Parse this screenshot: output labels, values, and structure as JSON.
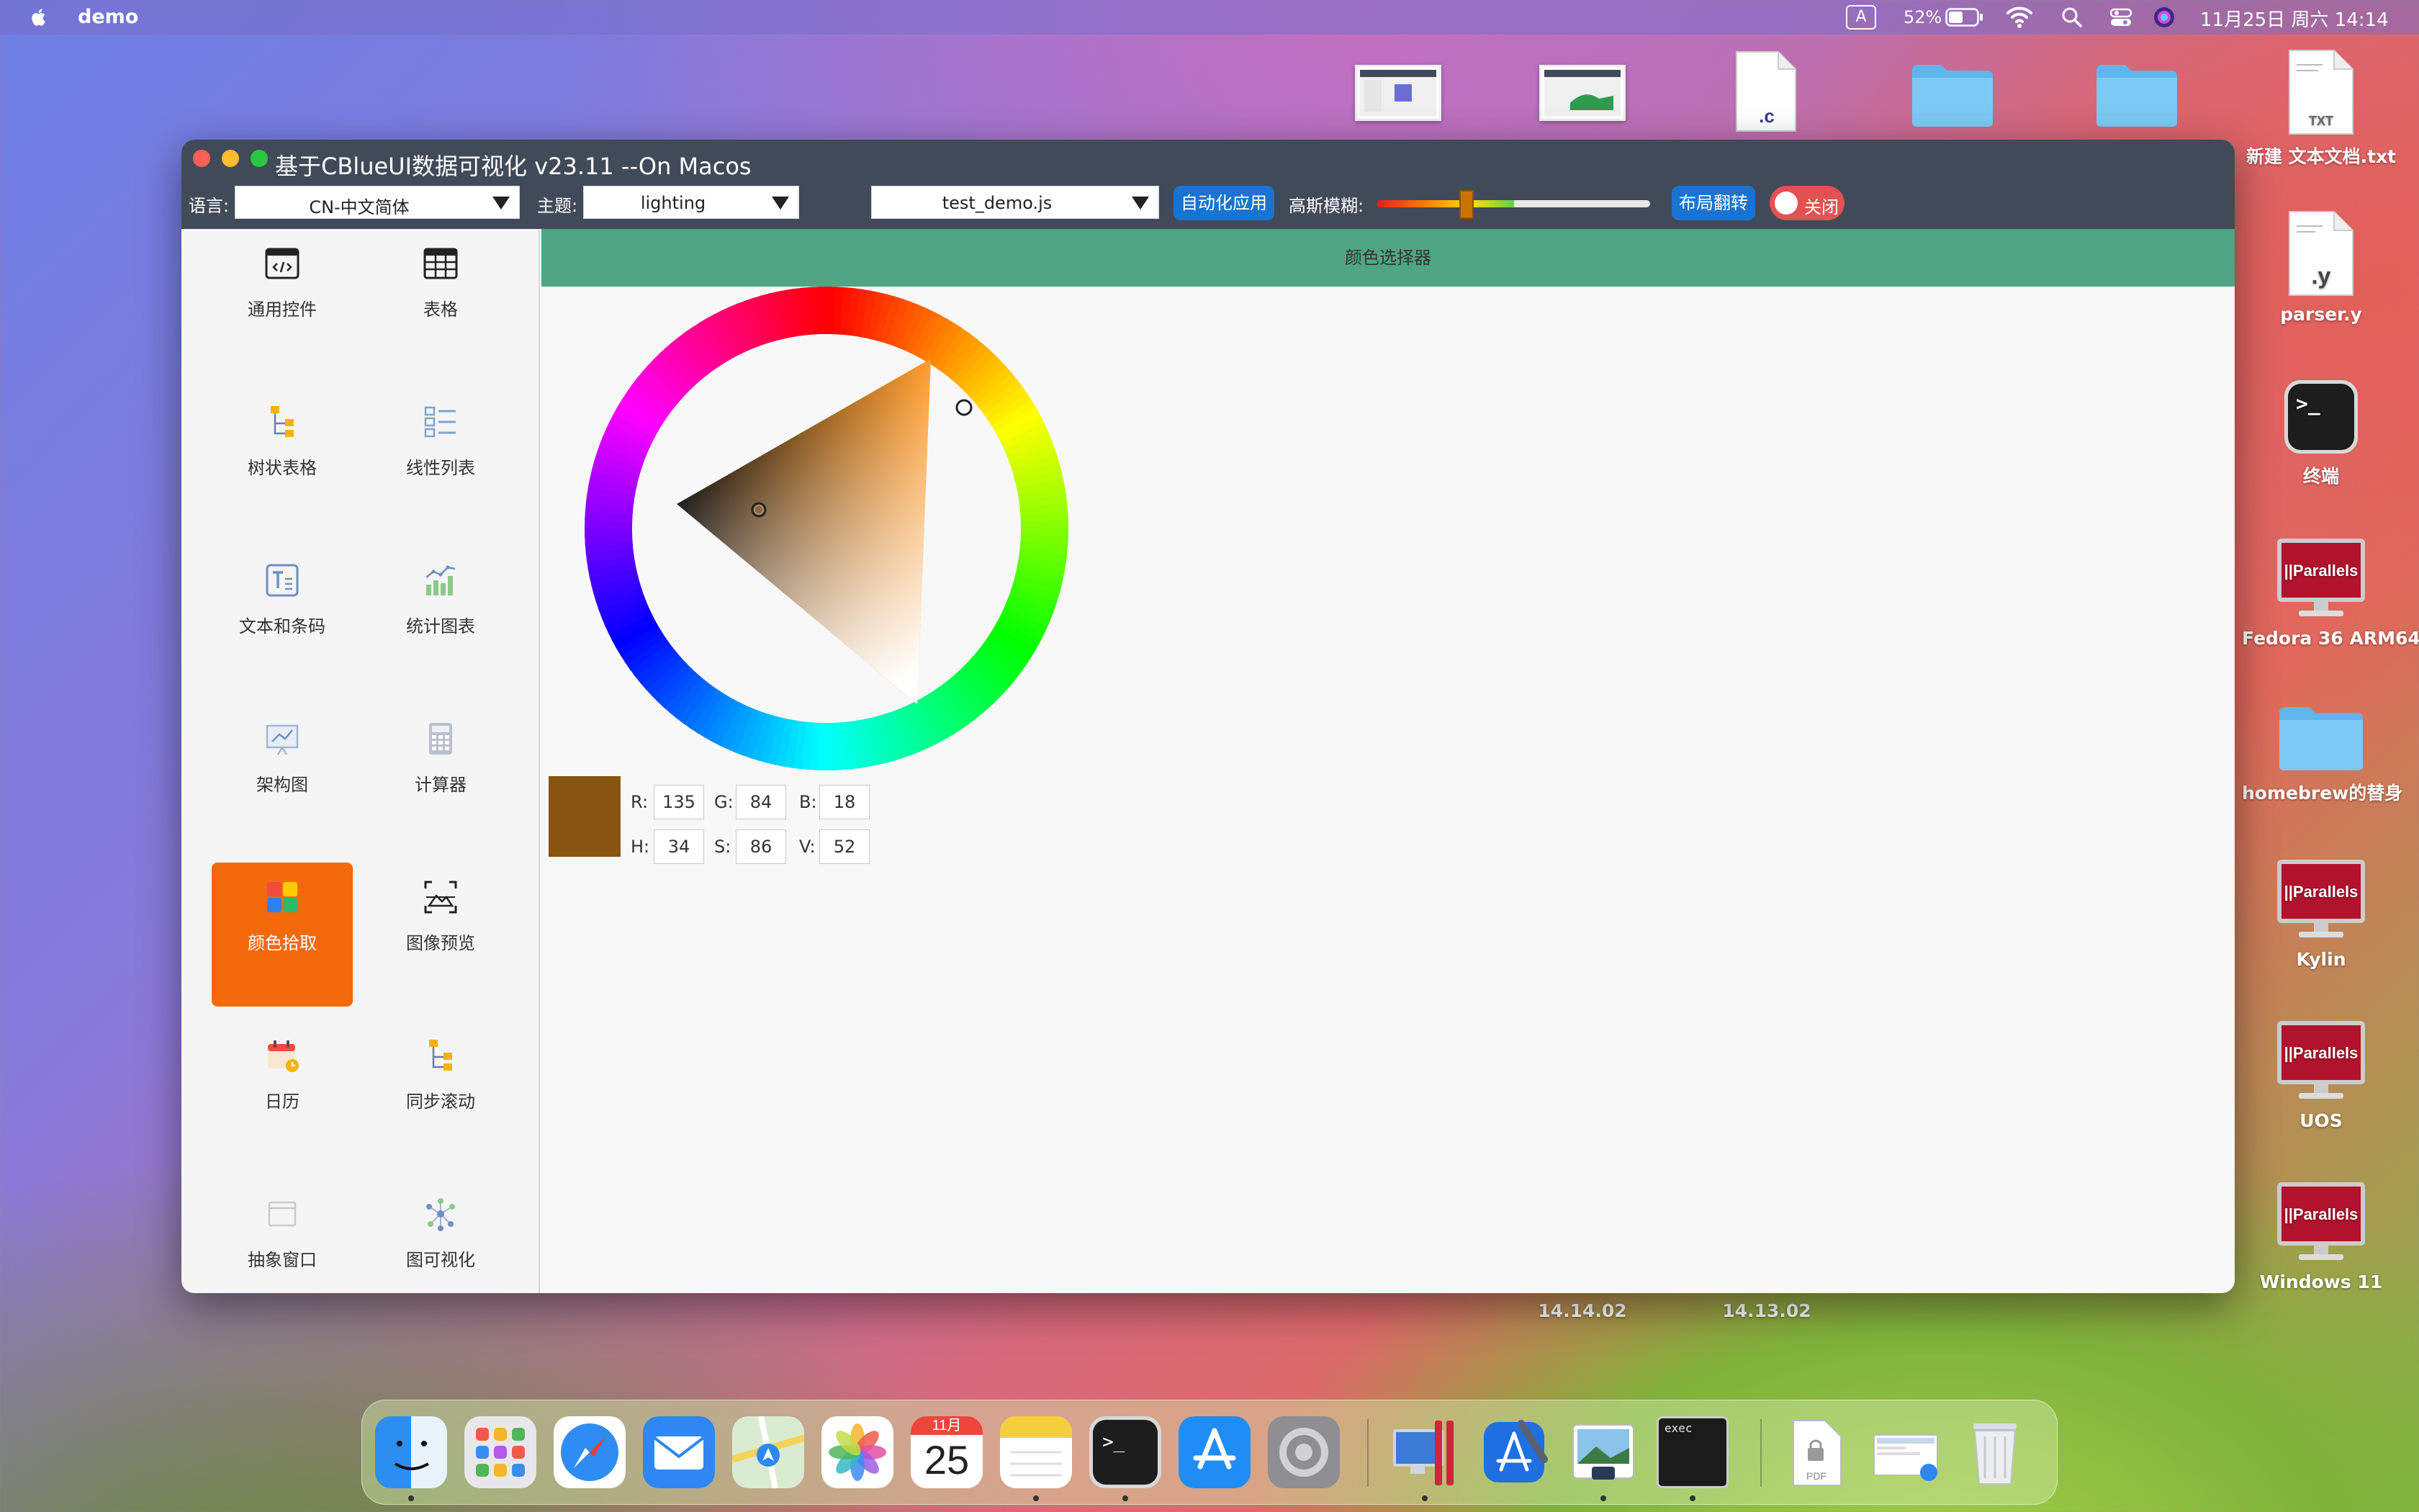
{
  "menubar": {
    "app_name": "demo",
    "input_source": "A",
    "battery_percent": "52%",
    "clock": "11月25日 周六  14:14"
  },
  "desktop": {
    "top_row_labels_partial": [
      "14.14.02",
      "14.13.02"
    ],
    "items": [
      {
        "label": "新建 文本文档.txt",
        "icon": "txt-file-icon",
        "badge": "TXT"
      },
      {
        "label": "parser.y",
        "icon": "y-file-icon",
        "badge": ".y"
      },
      {
        "label": "终端",
        "icon": "terminal-icon"
      },
      {
        "label": "Fedora 36 ARM64",
        "icon": "parallels-vm-icon"
      },
      {
        "label": "homebrew的替身",
        "icon": "folder-alias-icon"
      },
      {
        "label": "Kylin",
        "icon": "parallels-vm-icon"
      },
      {
        "label": "UOS",
        "icon": "parallels-vm-icon"
      },
      {
        "label": "Windows 11",
        "icon": "parallels-vm-icon"
      }
    ],
    "c_file_badge": ".c",
    "parallels_text": "||Parallels"
  },
  "window": {
    "title": "基于CBlueUI数据可视化 v23.11 --On Macos",
    "toolbar": {
      "language_label": "语言:",
      "language_value": "CN-中文简体",
      "theme_label": "主题:",
      "theme_value": "lighting",
      "script_value": "test_demo.js",
      "auto_apply_label": "自动化应用",
      "blur_label": "高斯模糊:",
      "blur_level": 0.33,
      "flip_layout_label": "布局翻转",
      "toggle_label": "关闭"
    },
    "sidebar": [
      {
        "label": "通用控件",
        "icon": "code-window-icon"
      },
      {
        "label": "表格",
        "icon": "table-icon"
      },
      {
        "label": "树状表格",
        "icon": "tree-table-icon"
      },
      {
        "label": "线性列表",
        "icon": "linear-list-icon"
      },
      {
        "label": "文本和条码",
        "icon": "text-barcode-icon"
      },
      {
        "label": "统计图表",
        "icon": "stat-chart-icon"
      },
      {
        "label": "架构图",
        "icon": "architecture-icon"
      },
      {
        "label": "计算器",
        "icon": "calculator-icon"
      },
      {
        "label": "颜色拾取",
        "icon": "color-picker-icon",
        "active": true
      },
      {
        "label": "图像预览",
        "icon": "image-preview-icon"
      },
      {
        "label": "日历",
        "icon": "calendar-icon"
      },
      {
        "label": "同步滚动",
        "icon": "sync-scroll-icon"
      },
      {
        "label": "抽象窗口",
        "icon": "abstract-window-icon"
      },
      {
        "label": "图可视化",
        "icon": "graph-visual-icon"
      }
    ],
    "content": {
      "header": "颜色选择器",
      "color": {
        "R_label": "R:",
        "R": "135",
        "G_label": "G:",
        "G": "84",
        "B_label": "B:",
        "B": "18",
        "H_label": "H:",
        "H": "34",
        "S_label": "S:",
        "S": "86",
        "V_label": "V:",
        "V": "52",
        "swatch": "#875412",
        "hue_color": "#ff9112"
      }
    }
  },
  "dock": {
    "calendar_month": "11月",
    "calendar_day": "25",
    "exec_label": "exec",
    "pdf_label": "PDF",
    "apps": [
      "finder-icon",
      "launchpad-icon",
      "safari-icon",
      "mail-icon",
      "maps-icon",
      "photos-icon",
      "calendar-icon",
      "notes-icon",
      "terminal-icon",
      "app-store-icon",
      "system-settings-icon",
      "parallels-icon",
      "xcode-icon",
      "preview-icon",
      "exec-icon",
      "pdf-doc-icon",
      "screenshot-icon",
      "trash-icon"
    ]
  },
  "colors": {
    "titlebar": "#414a59",
    "accent_blue": "#1874d0",
    "active_nav": "#f36a0c",
    "content_header": "#4fa584",
    "toggle_red": "#e25252"
  }
}
